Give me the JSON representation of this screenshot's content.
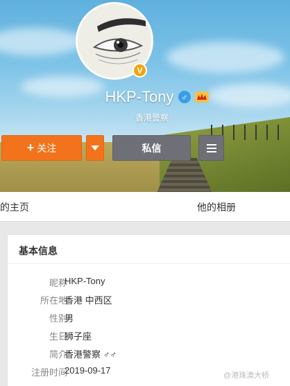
{
  "profile": {
    "name": "HKP-Tony",
    "gender_icon": "♂",
    "verified_badge": "V",
    "vip_badge": "vip-badge-icon",
    "description": "香港警察"
  },
  "actions": {
    "follow_label": "关注",
    "follow_icon": "+",
    "message_label": "私信"
  },
  "tabs": {
    "home": "的主页",
    "album": "他的相册"
  },
  "info": {
    "title": "基本信息",
    "rows": [
      {
        "key": "昵称",
        "value": "HKP-Tony"
      },
      {
        "key": "所在地",
        "value": "香港 中西区"
      },
      {
        "key": "性别",
        "value": "男"
      },
      {
        "key": "生日",
        "value": "狮子座"
      },
      {
        "key": "简介",
        "value": "香港警察 ♂♂"
      },
      {
        "key": "注册时间",
        "value": "2019-09-17"
      }
    ]
  },
  "watermark": "@港珠澳大桥"
}
